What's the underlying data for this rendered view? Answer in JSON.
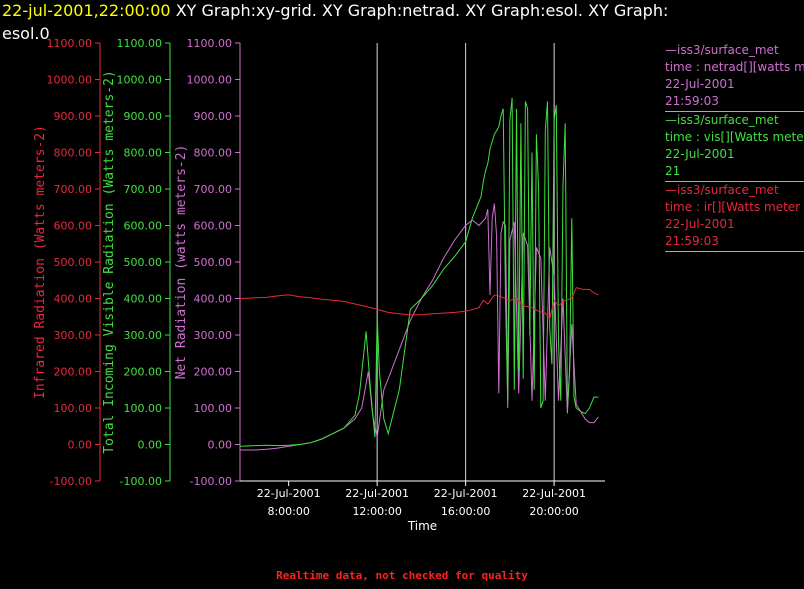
{
  "header": {
    "timestamp": "22-jul-2001,22:00:00",
    "title_rest": "XY Graph:xy-grid.  XY Graph:netrad.  XY Graph:esol.  XY Graph:",
    "title_line2": "esol.0"
  },
  "colors": {
    "background": "#000000",
    "ir": "#e8283c",
    "vis": "#40e040",
    "net": "#d070d0",
    "axis_text": "#ffffff",
    "grid": "#ffffff",
    "timestamp": "#ffff00"
  },
  "legend": [
    {
      "station": "—iss3/surface_met",
      "variable": "time : netrad[][watts me",
      "date": "22-Jul-2001",
      "time": "21:59:03",
      "color": "#d070d0"
    },
    {
      "station": "—iss3/surface_met",
      "variable": "time : vis[][Watts mete",
      "date": "22-Jul-2001",
      "time": "21",
      "color": "#40e040"
    },
    {
      "station": "—iss3/surface_met",
      "variable": "time : ir[][Watts meter",
      "date": "22-Jul-2001",
      "time": "21:59:03",
      "color": "#e8283c"
    }
  ],
  "footer": {
    "warning": "Realtime data, not checked for quality"
  },
  "chart_data": {
    "type": "line",
    "xlabel": "Time",
    "x_ticks": [
      {
        "date": "22-Jul-2001",
        "time": "8:00:00",
        "hour": 8
      },
      {
        "date": "22-Jul-2001",
        "time": "12:00:00",
        "hour": 12
      },
      {
        "date": "22-Jul-2001",
        "time": "16:00:00",
        "hour": 16
      },
      {
        "date": "22-Jul-2001",
        "time": "20:00:00",
        "hour": 20
      }
    ],
    "xlim": [
      5.8,
      22.3
    ],
    "vertical_gridlines_hours": [
      12,
      16,
      20
    ],
    "y_axes": [
      {
        "label": "Infrared Radiation (Watts meters-2)",
        "color": "#e8283c",
        "ylim": [
          -100,
          1100
        ],
        "ticks": [
          "-100.00",
          "0.00",
          "100.00",
          "200.00",
          "300.00",
          "400.00",
          "500.00",
          "600.00",
          "700.00",
          "800.00",
          "900.00",
          "1000.00",
          "1100.00"
        ]
      },
      {
        "label": "Total Incoming Visible Radiation (Watts meters-2)",
        "color": "#40e040",
        "ylim": [
          -100,
          1100
        ],
        "ticks": [
          "-100.00",
          "0.00",
          "100.00",
          "200.00",
          "300.00",
          "400.00",
          "500.00",
          "600.00",
          "700.00",
          "800.00",
          "900.00",
          "1000.00",
          "1100.00"
        ]
      },
      {
        "label": "Net Radiation (watts meters-2)",
        "color": "#d070d0",
        "ylim": [
          -100,
          1100
        ],
        "ticks": [
          "-100.00",
          "0.00",
          "100.00",
          "200.00",
          "300.00",
          "400.00",
          "500.00",
          "600.00",
          "700.00",
          "800.00",
          "900.00",
          "1000.00",
          "1100.00"
        ]
      }
    ],
    "series": [
      {
        "name": "ir",
        "color": "#e8283c",
        "x": [
          5.8,
          6.5,
          7,
          7.5,
          8,
          8.5,
          9,
          9.5,
          10,
          10.5,
          11,
          11.5,
          12,
          12.5,
          13,
          13.5,
          14,
          14.5,
          15,
          15.5,
          16,
          16.2,
          16.6,
          16.8,
          17,
          17.3,
          17.6,
          18,
          18.3,
          18.6,
          19,
          19.3,
          19.6,
          19.8,
          20,
          20.2,
          20.5,
          20.8,
          21,
          21.3,
          21.6,
          21.8,
          22
        ],
        "y": [
          400,
          402,
          403,
          407,
          410,
          405,
          402,
          398,
          395,
          392,
          385,
          378,
          370,
          362,
          358,
          355,
          356,
          358,
          360,
          362,
          365,
          368,
          375,
          395,
          385,
          410,
          405,
          395,
          400,
          380,
          375,
          365,
          360,
          345,
          395,
          380,
          395,
          400,
          430,
          425,
          425,
          415,
          410
        ]
      },
      {
        "name": "vis",
        "color": "#40e040",
        "x": [
          5.8,
          6.5,
          7,
          7.5,
          8,
          8.5,
          9,
          9.5,
          10,
          10.5,
          11,
          11.2,
          11.5,
          11.7,
          11.9,
          12,
          12.1,
          12.3,
          12.5,
          13,
          13.5,
          14,
          14.5,
          15,
          15.5,
          16,
          16.3,
          16.5,
          16.7,
          16.8,
          16.9,
          17,
          17.1,
          17.2,
          17.3,
          17.4,
          17.5,
          17.6,
          17.7,
          17.8,
          17.9,
          18,
          18.1,
          18.2,
          18.3,
          18.4,
          18.5,
          18.6,
          18.7,
          18.8,
          18.9,
          19,
          19.1,
          19.2,
          19.3,
          19.4,
          19.5,
          19.6,
          19.7,
          19.8,
          19.9,
          20,
          20.1,
          20.2,
          20.3,
          20.4,
          20.5,
          20.6,
          20.7,
          20.8,
          20.9,
          21,
          21.2,
          21.4,
          21.6,
          21.8,
          22
        ],
        "y": [
          -5,
          -3,
          -2,
          -3,
          -2,
          0,
          5,
          15,
          30,
          45,
          80,
          140,
          310,
          150,
          20,
          350,
          200,
          70,
          30,
          150,
          370,
          400,
          435,
          480,
          515,
          555,
          620,
          650,
          680,
          720,
          750,
          770,
          810,
          830,
          850,
          860,
          870,
          900,
          920,
          400,
          120,
          890,
          950,
          150,
          920,
          200,
          880,
          180,
          940,
          920,
          300,
          800,
          150,
          850,
          700,
          100,
          120,
          860,
          940,
          320,
          220,
          890,
          930,
          280,
          120,
          710,
          880,
          100,
          200,
          620,
          130,
          100,
          90,
          85,
          100,
          130,
          130
        ]
      },
      {
        "name": "net",
        "color": "#d070d0",
        "x": [
          5.8,
          6.5,
          7,
          7.5,
          8,
          8.5,
          9,
          9.5,
          10,
          10.5,
          11,
          11.3,
          11.6,
          11.8,
          12,
          12.3,
          12.5,
          13,
          13.5,
          14,
          14.5,
          15,
          15.5,
          16,
          16.3,
          16.6,
          16.9,
          17,
          17.1,
          17.2,
          17.3,
          17.4,
          17.5,
          17.6,
          17.7,
          17.8,
          17.9,
          18,
          18.2,
          18.4,
          18.6,
          18.8,
          19,
          19.2,
          19.4,
          19.6,
          19.8,
          20,
          20.2,
          20.4,
          20.6,
          20.8,
          21,
          21.2,
          21.4,
          21.6,
          21.8,
          22
        ],
        "y": [
          -15,
          -15,
          -13,
          -10,
          -5,
          0,
          5,
          15,
          30,
          45,
          70,
          100,
          200,
          80,
          20,
          150,
          180,
          260,
          340,
          400,
          450,
          510,
          560,
          600,
          615,
          600,
          620,
          645,
          410,
          620,
          660,
          570,
          140,
          580,
          610,
          600,
          100,
          560,
          610,
          140,
          580,
          545,
          120,
          540,
          510,
          120,
          540,
          460,
          120,
          400,
          85,
          330,
          110,
          90,
          70,
          60,
          60,
          75
        ]
      }
    ]
  }
}
